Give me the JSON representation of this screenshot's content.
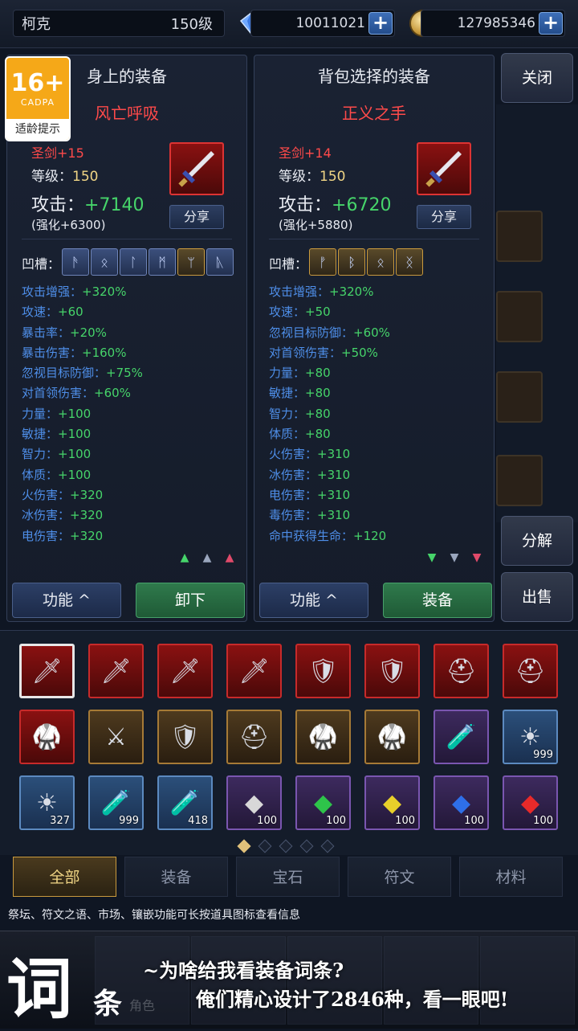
{
  "topbar": {
    "player_name": "柯克",
    "player_level": "150级",
    "diamonds": "10011021",
    "gold": "127985346",
    "plus_label": "+"
  },
  "age_badge": {
    "age": "16+",
    "org": "CADPA",
    "tip": "适龄提示"
  },
  "left_panel": {
    "header": "身上的装备",
    "item_name": "风亡呼吸",
    "item_type": "圣剑+15",
    "level_label": "等级：",
    "level_value": "150",
    "attack_label": "攻击：",
    "attack_value": "+7140",
    "enhance": "(强化+6300)",
    "share_label": "分享",
    "slots_label": "凹槽：",
    "slots": [
      "ᚫ",
      "ᛟ",
      "ᛚ",
      "ᛗ",
      "ᛘ",
      "ᚣ"
    ],
    "stats": [
      {
        "k": "攻击增强：",
        "v": "+320%"
      },
      {
        "k": "攻速：",
        "v": "+60"
      },
      {
        "k": "暴击率：",
        "v": "+20%"
      },
      {
        "k": "暴击伤害：",
        "v": "+160%"
      },
      {
        "k": "忽视目标防御：",
        "v": "+75%"
      },
      {
        "k": "对首领伤害：",
        "v": "+60%"
      },
      {
        "k": "力量：",
        "v": "+100"
      },
      {
        "k": "敏捷：",
        "v": "+100"
      },
      {
        "k": "智力：",
        "v": "+100"
      },
      {
        "k": "体质：",
        "v": "+100"
      },
      {
        "k": "火伤害：",
        "v": "+320"
      },
      {
        "k": "冰伤害：",
        "v": "+320"
      },
      {
        "k": "电伤害：",
        "v": "+320"
      }
    ],
    "func_label": "功能 ^",
    "action_label": "卸下"
  },
  "right_panel": {
    "header": "背包选择的装备",
    "item_name": "正义之手",
    "item_type": "圣剑+14",
    "level_label": "等级：",
    "level_value": "150",
    "attack_label": "攻击：",
    "attack_value": "+6720",
    "enhance": "(强化+5880)",
    "share_label": "分享",
    "slots_label": "凹槽：",
    "slots": [
      "ᚡ",
      "ᛒ",
      "ᛟ",
      "ᛝ"
    ],
    "stats": [
      {
        "k": "攻击增强：",
        "v": "+320%"
      },
      {
        "k": "攻速：",
        "v": "+50"
      },
      {
        "k": "忽视目标防御：",
        "v": "+60%"
      },
      {
        "k": "对首领伤害：",
        "v": "+50%"
      },
      {
        "k": "力量：",
        "v": "+80"
      },
      {
        "k": "敏捷：",
        "v": "+80"
      },
      {
        "k": "智力：",
        "v": "+80"
      },
      {
        "k": "体质：",
        "v": "+80"
      },
      {
        "k": "火伤害：",
        "v": "+310"
      },
      {
        "k": "冰伤害：",
        "v": "+310"
      },
      {
        "k": "电伤害：",
        "v": "+310"
      },
      {
        "k": "毒伤害：",
        "v": "+310"
      },
      {
        "k": "命中获得生命：",
        "v": "+120"
      }
    ],
    "func_label": "功能 ^",
    "action_label": "装备"
  },
  "side_buttons": {
    "close": "关闭",
    "decompose": "分解",
    "sell": "出售"
  },
  "inventory": {
    "items": [
      {
        "icon": "🗡",
        "style": "red",
        "count": ""
      },
      {
        "icon": "🗡",
        "style": "red",
        "count": ""
      },
      {
        "icon": "🗡",
        "style": "red",
        "count": ""
      },
      {
        "icon": "🗡",
        "style": "red",
        "count": ""
      },
      {
        "icon": "🛡",
        "style": "red",
        "count": ""
      },
      {
        "icon": "🛡",
        "style": "red",
        "count": ""
      },
      {
        "icon": "⛑",
        "style": "red",
        "count": ""
      },
      {
        "icon": "⛑",
        "style": "red",
        "count": ""
      },
      {
        "icon": "🥋",
        "style": "red",
        "count": ""
      },
      {
        "icon": "⚔",
        "style": "gold",
        "count": ""
      },
      {
        "icon": "🛡",
        "style": "gold",
        "count": ""
      },
      {
        "icon": "⛑",
        "style": "gold",
        "count": ""
      },
      {
        "icon": "🥋",
        "style": "gold",
        "count": ""
      },
      {
        "icon": "🥋",
        "style": "gold",
        "count": ""
      },
      {
        "icon": "🧪",
        "style": "purple",
        "count": ""
      },
      {
        "icon": "☀",
        "style": "blue",
        "count": "999"
      },
      {
        "icon": "☀",
        "style": "blue",
        "count": "327"
      },
      {
        "icon": "🧪",
        "style": "blue",
        "count": "999"
      },
      {
        "icon": "🧪",
        "style": "blue",
        "count": "418"
      },
      {
        "icon": "◆",
        "style": "purple",
        "count": "100",
        "color": "#d8d8d8"
      },
      {
        "icon": "◆",
        "style": "purple",
        "count": "100",
        "color": "#2ec44a"
      },
      {
        "icon": "◆",
        "style": "purple",
        "count": "100",
        "color": "#e8d02a"
      },
      {
        "icon": "◆",
        "style": "purple",
        "count": "100",
        "color": "#2e6fe8"
      },
      {
        "icon": "◆",
        "style": "purple",
        "count": "100",
        "color": "#e82a2a"
      }
    ]
  },
  "tabs": [
    "全部",
    "装备",
    "宝石",
    "符文",
    "材料"
  ],
  "hint": "祭坛、符文之语、市场、镶嵌功能可长按道具图标查看信息",
  "promo": {
    "big_char": "词",
    "small_char": "条",
    "line1": "~为啥给我看装备词条?",
    "line2": "俺们精心设计了2846种，看一眼吧!",
    "nav_labels": [
      "角色",
      "",
      "",
      "",
      ""
    ]
  },
  "colors": {
    "accent_green": "#46d46a",
    "stat_blue": "#4e8ee8",
    "item_red": "#ff4a4a",
    "gold": "#f0d585"
  }
}
